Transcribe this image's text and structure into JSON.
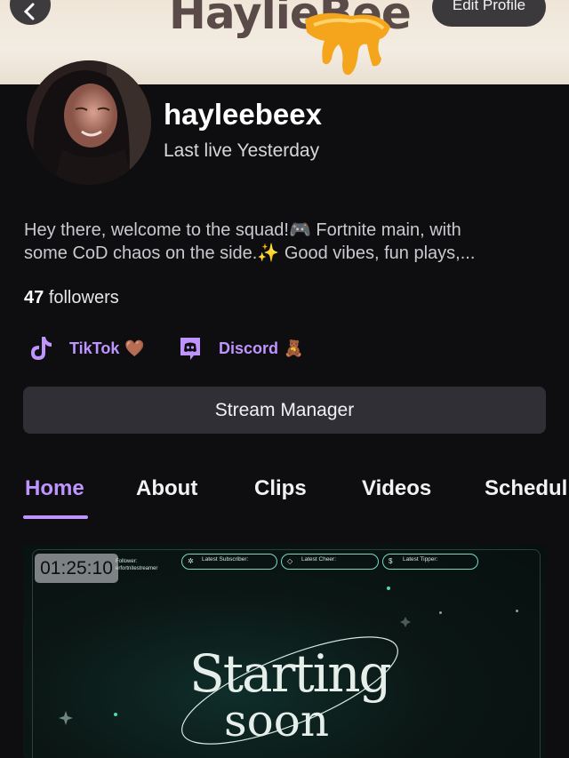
{
  "banner": {
    "title": "HaylieBee",
    "edit_label": "Edit Profile"
  },
  "profile": {
    "username": "hayleebeex",
    "last_live": "Last live Yesterday",
    "bio_line1": "Hey there, welcome to the squad!🎮 Fortnite main, with",
    "bio_line2": "some CoD chaos on the side.✨ Good vibes, fun plays,...",
    "follower_count": "47",
    "followers_label": "followers"
  },
  "socials": [
    {
      "label": "TikTok",
      "emoji": "🤎",
      "icon": "tiktok-icon"
    },
    {
      "label": "Discord",
      "emoji": "🧸",
      "icon": "discord-icon"
    }
  ],
  "stream_manager_label": "Stream Manager",
  "tabs": [
    {
      "label": "Home",
      "active": true
    },
    {
      "label": "About"
    },
    {
      "label": "Clips"
    },
    {
      "label": "Videos"
    },
    {
      "label": "Schedul"
    }
  ],
  "video": {
    "duration": "01:25:10",
    "overlay": {
      "follower_label": "Follower:",
      "follower_name": "erfortnitestreamer",
      "subscriber_label": "Latest Subscriber:",
      "cheer_label": "Latest Cheer:",
      "tipper_label": "Latest Tipper:"
    },
    "title_line1": "Starting",
    "title_line2": "soon"
  },
  "colors": {
    "accent": "#bf94ff",
    "background": "#0e0e10",
    "button": "#2f2f35"
  }
}
